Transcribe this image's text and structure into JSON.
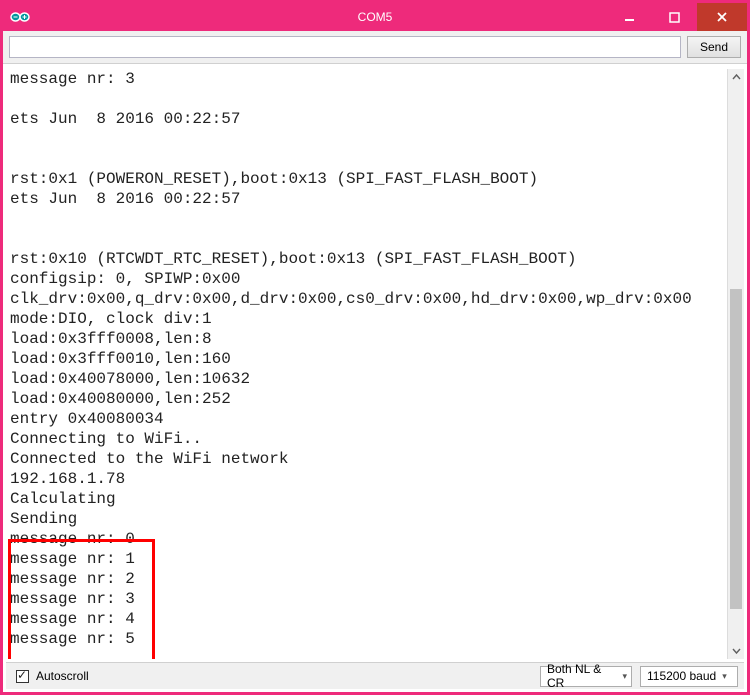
{
  "window": {
    "title": "COM5"
  },
  "toolbar": {
    "send_label": "Send",
    "input_value": ""
  },
  "console_lines": [
    "message nr: 3",
    "",
    "ets Jun  8 2016 00:22:57",
    "",
    "",
    "rst:0x1 (POWERON_RESET),boot:0x13 (SPI_FAST_FLASH_BOOT)",
    "ets Jun  8 2016 00:22:57",
    "",
    "",
    "rst:0x10 (RTCWDT_RTC_RESET),boot:0x13 (SPI_FAST_FLASH_BOOT)",
    "configsip: 0, SPIWP:0x00",
    "clk_drv:0x00,q_drv:0x00,d_drv:0x00,cs0_drv:0x00,hd_drv:0x00,wp_drv:0x00",
    "mode:DIO, clock div:1",
    "load:0x3fff0008,len:8",
    "load:0x3fff0010,len:160",
    "load:0x40078000,len:10632",
    "load:0x40080000,len:252",
    "entry 0x40080034",
    "Connecting to WiFi..",
    "Connected to the WiFi network",
    "192.168.1.78",
    "Calculating",
    "Sending",
    "message nr: 0",
    "message nr: 1",
    "message nr: 2",
    "message nr: 3",
    "message nr: 4",
    "message nr: 5",
    ""
  ],
  "status": {
    "autoscroll_label": "Autoscroll",
    "autoscroll_checked": true,
    "line_ending_selected": "Both NL & CR",
    "baud_selected": "115200 baud"
  },
  "colors": {
    "accent": "#ee2a7b",
    "close_btn": "#c0392b",
    "highlight_border": "#ff0000"
  },
  "icons": {
    "app": "arduino-infinity-icon",
    "minimize": "minimize-icon",
    "maximize": "maximize-icon",
    "close": "close-icon",
    "scroll_up": "chevron-up-icon",
    "scroll_down": "chevron-down-icon",
    "dropdown": "chevron-down-icon"
  }
}
